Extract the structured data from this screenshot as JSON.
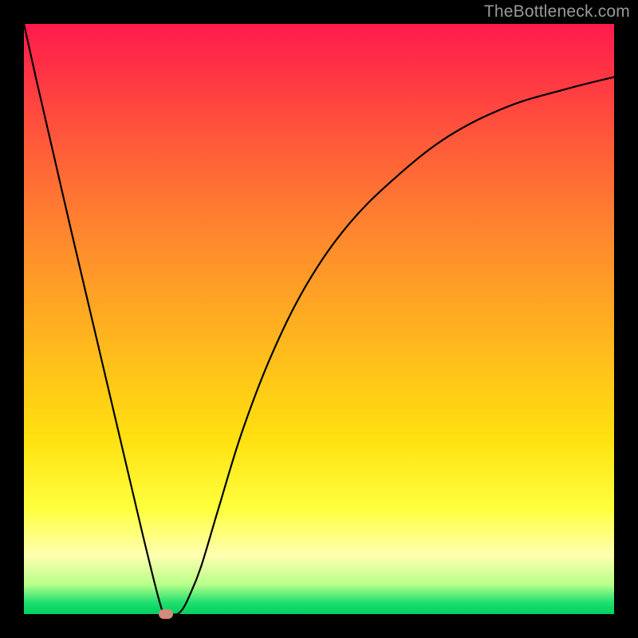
{
  "watermark": "TheBottleneck.com",
  "chart_data": {
    "type": "line",
    "title": "",
    "xlabel": "",
    "ylabel": "",
    "xlim": [
      0,
      100
    ],
    "ylim": [
      0,
      100
    ],
    "series": [
      {
        "name": "curve",
        "x": [
          0,
          2,
          5,
          8,
          12,
          16,
          20,
          23,
          24,
          25,
          26,
          27,
          28,
          30,
          33,
          37,
          42,
          48,
          55,
          63,
          72,
          82,
          92,
          100
        ],
        "values": [
          100,
          91,
          78,
          65,
          48,
          31,
          14,
          2,
          0,
          0,
          0,
          1,
          3,
          8,
          18,
          31,
          44,
          56,
          66,
          74,
          81,
          86,
          89,
          91
        ]
      }
    ],
    "marker": {
      "x": 24,
      "y": 0,
      "color": "#d48a7a"
    },
    "gradient_stops": [
      {
        "pos": 0.0,
        "color": "#ff1a4d"
      },
      {
        "pos": 0.82,
        "color": "#ffff3d"
      },
      {
        "pos": 1.0,
        "color": "#00d060"
      }
    ]
  }
}
